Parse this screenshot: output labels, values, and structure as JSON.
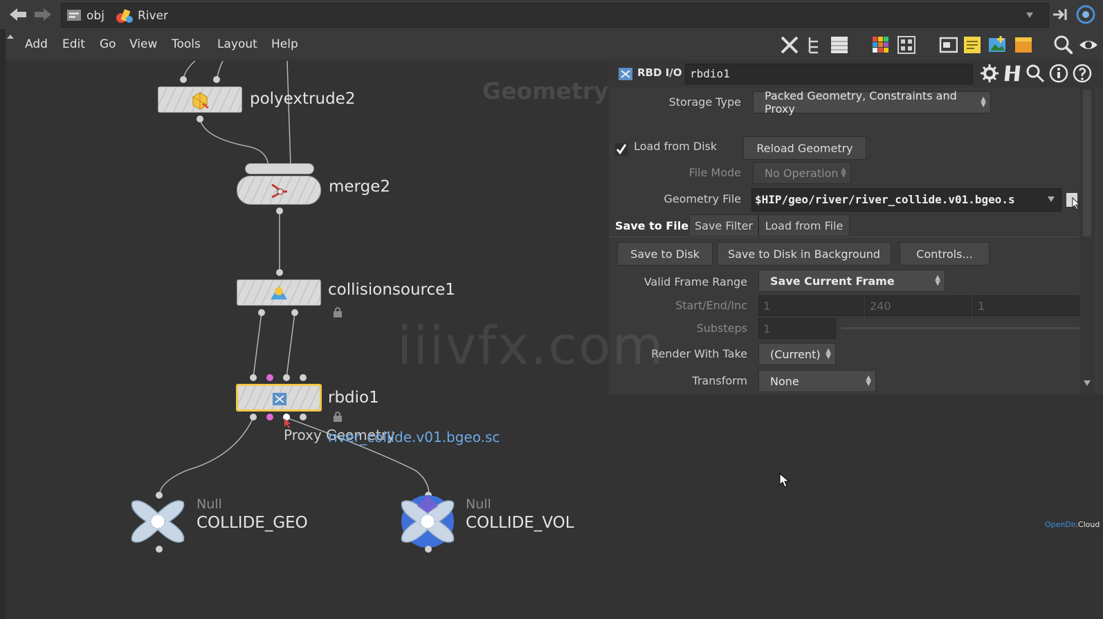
{
  "pathbar": {
    "level1": "obj",
    "level2": "River"
  },
  "menubar": {
    "items": [
      "Add",
      "Edit",
      "Go",
      "View",
      "Tools",
      "Layout",
      "Help"
    ]
  },
  "network": {
    "context_label": "Geometry",
    "nodes": {
      "polyextrude": "polyextrude2",
      "merge": "merge2",
      "collisionsource": "collisionsource1",
      "rbdio": "rbdio1",
      "null1_type": "Null",
      "null1_name": "COLLIDE_GEO",
      "null2_type": "Null",
      "null2_name": "COLLIDE_VOL"
    },
    "tooltip_output": "Proxy Geometry",
    "tooltip_file": "river_collide.v01.bgeo.sc",
    "watermark": "iiivfx.com"
  },
  "params": {
    "node_type": "RBD I/O",
    "node_name": "rbdio1",
    "storage_type_label": "Storage Type",
    "storage_type_value": "Packed Geometry, Constraints and Proxy",
    "load_from_disk_label": "Load from Disk",
    "load_from_disk_checked": true,
    "reload_geometry": "Reload Geometry",
    "file_mode_label": "File Mode",
    "file_mode_value": "No Operation",
    "geometry_file_label": "Geometry File",
    "geometry_file_value": "$HIP/geo/river/river_collide.v01.bgeo.s",
    "tabs": [
      "Save to File",
      "Save Filter",
      "Load from File"
    ],
    "save_to_disk": "Save to Disk",
    "save_bg": "Save to Disk in Background",
    "controls": "Controls...",
    "valid_frame_range_label": "Valid Frame Range",
    "valid_frame_range_value": "Save Current Frame",
    "start_end_inc_label": "Start/End/Inc",
    "start_value": "1",
    "end_value": "240",
    "inc_value": "1",
    "substeps_label": "Substeps",
    "substeps_value": "1",
    "render_with_take_label": "Render With Take",
    "render_with_take_value": "(Current)",
    "transform_label": "Transform",
    "transform_value": "None"
  },
  "branding": {
    "part1": "OpenDir",
    "part2": ".Cloud"
  },
  "colors": {
    "selected_node_border": "#f2c94c",
    "pink_port": "#e06ad8",
    "link_blue": "#6aa9e8"
  }
}
